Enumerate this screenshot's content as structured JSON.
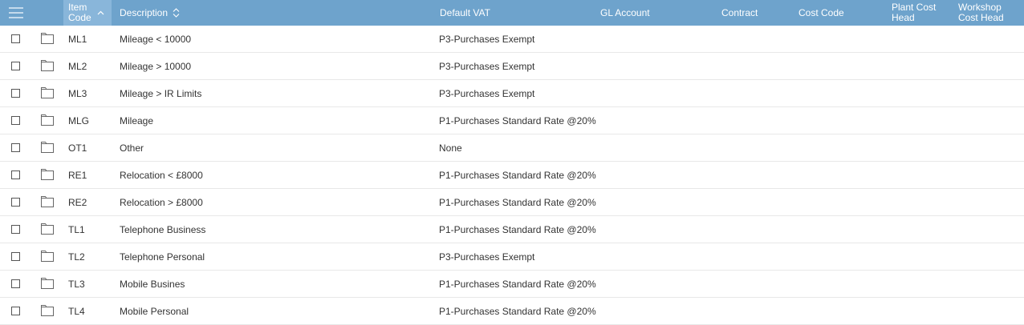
{
  "header": {
    "col_item_code": "Item Code",
    "col_item_code_l1": "Item",
    "col_item_code_l2": "Code",
    "col_description": "Description",
    "col_default_vat": "Default VAT",
    "col_gl_account": "GL Account",
    "col_contract": "Contract",
    "col_cost_code": "Cost Code",
    "col_plant_l1": "Plant Cost",
    "col_plant_l2": "Head",
    "col_workshop_l1": "Workshop",
    "col_workshop_l2": "Cost Head",
    "sort_column": "Item Code",
    "sort_direction": "ascending",
    "icons": {
      "menu": "hamburger-menu-icon",
      "sort_asc": "chevron-up-icon",
      "sort_both": "sort-up-down-icon"
    }
  },
  "rows": [
    {
      "code": "ML1",
      "description": "Mileage < 10000",
      "vat": "P3-Purchases Exempt",
      "gl_account": "",
      "contract": "",
      "cost_code": "",
      "plant": "",
      "workshop": ""
    },
    {
      "code": "ML2",
      "description": "Mileage > 10000",
      "vat": "P3-Purchases Exempt",
      "gl_account": "",
      "contract": "",
      "cost_code": "",
      "plant": "",
      "workshop": ""
    },
    {
      "code": "ML3",
      "description": "Mileage > IR Limits",
      "vat": "P3-Purchases Exempt",
      "gl_account": "",
      "contract": "",
      "cost_code": "",
      "plant": "",
      "workshop": ""
    },
    {
      "code": "MLG",
      "description": "Mileage",
      "vat": "P1-Purchases Standard Rate @20%",
      "gl_account": "",
      "contract": "",
      "cost_code": "",
      "plant": "",
      "workshop": ""
    },
    {
      "code": "OT1",
      "description": "Other",
      "vat": "None",
      "gl_account": "",
      "contract": "",
      "cost_code": "",
      "plant": "",
      "workshop": ""
    },
    {
      "code": "RE1",
      "description": "Relocation < £8000",
      "vat": "P1-Purchases Standard Rate @20%",
      "gl_account": "",
      "contract": "",
      "cost_code": "",
      "plant": "",
      "workshop": ""
    },
    {
      "code": "RE2",
      "description": "Relocation > £8000",
      "vat": "P1-Purchases Standard Rate @20%",
      "gl_account": "",
      "contract": "",
      "cost_code": "",
      "plant": "",
      "workshop": ""
    },
    {
      "code": "TL1",
      "description": "Telephone Business",
      "vat": "P1-Purchases Standard Rate @20%",
      "gl_account": "",
      "contract": "",
      "cost_code": "",
      "plant": "",
      "workshop": ""
    },
    {
      "code": "TL2",
      "description": "Telephone Personal",
      "vat": "P3-Purchases Exempt",
      "gl_account": "",
      "contract": "",
      "cost_code": "",
      "plant": "",
      "workshop": ""
    },
    {
      "code": "TL3",
      "description": "Mobile Busines",
      "vat": "P1-Purchases Standard Rate @20%",
      "gl_account": "",
      "contract": "",
      "cost_code": "",
      "plant": "",
      "workshop": ""
    },
    {
      "code": "TL4",
      "description": "Mobile Personal",
      "vat": "P1-Purchases Standard Rate @20%",
      "gl_account": "",
      "contract": "",
      "cost_code": "",
      "plant": "",
      "workshop": ""
    }
  ],
  "row_icons": {
    "select": "checkbox-icon",
    "open": "folder-icon"
  },
  "colors": {
    "header_bg": "#6ea3cc",
    "header_sorted_bg": "#89b6da",
    "header_text": "#ffffff",
    "row_border": "#e8e8e8",
    "text": "#333333"
  }
}
